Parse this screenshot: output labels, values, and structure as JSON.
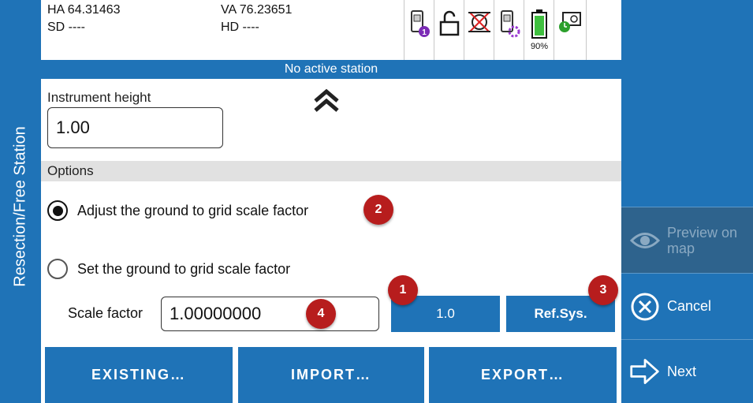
{
  "side_title": "Resection/Free Station",
  "status": {
    "ha": "HA 64.31463",
    "va": "VA 76.23651",
    "sd": "SD ----",
    "hd": "HD ----",
    "battery_percent": "90%",
    "icons": [
      "instrument-1-icon",
      "unlock-icon",
      "no-prism-icon",
      "instrument-settings-icon",
      "battery-icon",
      "camera-clock-icon"
    ],
    "station": "No active station"
  },
  "instrument_height": {
    "label": "Instrument height",
    "value": "1.00"
  },
  "options": {
    "header": "Options",
    "adjust_label": "Adjust the ground to grid scale factor",
    "set_label": "Set the ground to grid scale factor",
    "selected": "adjust"
  },
  "scale_factor": {
    "label": "Scale factor",
    "value": "1.00000000"
  },
  "buttons": {
    "one_point_zero": "1.0",
    "ref_sys": "Ref.Sys.",
    "existing": "EXISTING…",
    "import": "IMPORT…",
    "export": "EXPORT…"
  },
  "badges": {
    "b1": "1",
    "b2": "2",
    "b3": "3",
    "b4": "4"
  },
  "actions": {
    "preview": "Preview on map",
    "cancel": "Cancel",
    "next": "Next"
  },
  "colors": {
    "primary": "#1f73b7",
    "badge": "#b71d1d",
    "disabled": "#2e638d"
  }
}
